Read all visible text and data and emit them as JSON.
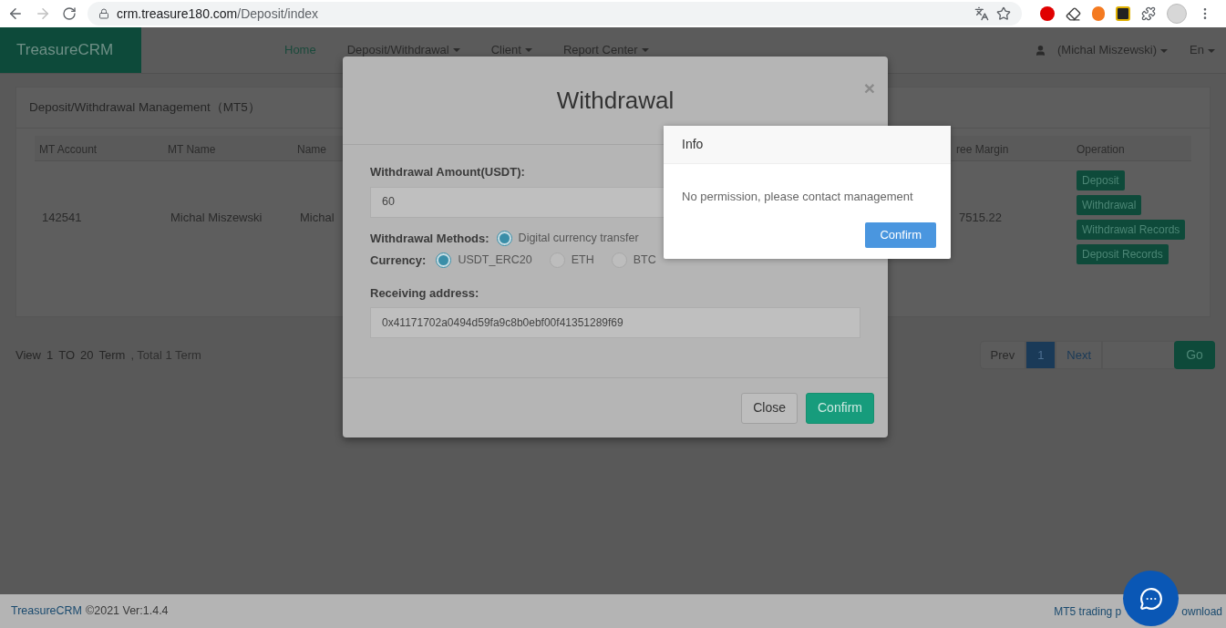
{
  "browser": {
    "url_host": "crm.treasure180.com",
    "url_path": "/Deposit/index"
  },
  "navbar": {
    "logo": "TreasureCRM",
    "items": [
      {
        "label": "Home",
        "selected": true,
        "dropdown": false
      },
      {
        "label": "Deposit/Withdrawal",
        "selected": false,
        "dropdown": true
      },
      {
        "label": "Client",
        "selected": false,
        "dropdown": true
      },
      {
        "label": "Report Center",
        "selected": false,
        "dropdown": true
      }
    ],
    "user": "(Michal Miszewski)",
    "language": "En"
  },
  "panel": {
    "title": "Deposit/Withdrawal Management（MT5）",
    "table": {
      "columns": [
        "MT Account",
        "MT Name",
        "Name",
        "ree Margin",
        "Operation"
      ],
      "rows": [
        {
          "cells": [
            "142541",
            "Michal Miszewski",
            "Michal",
            "7515.22"
          ],
          "actions": [
            "Deposit",
            "Withdrawal",
            "Withdrawal Records",
            "Deposit Records"
          ]
        }
      ]
    }
  },
  "pagination": {
    "summary_parts": [
      "View",
      "1",
      "TO",
      "20",
      "Term"
    ],
    "total": ", Total 1 Term",
    "prev": "Prev",
    "pages": [
      {
        "label": "1",
        "selected": true
      }
    ],
    "next": "Next",
    "go": "Go"
  },
  "footer": {
    "brand": "TreasureCRM",
    "copyright": "©2021 Ver:1.4.4",
    "link_parts": [
      "MT5 trading p",
      "ownload"
    ]
  },
  "withdrawal_dialog": {
    "title": "Withdrawal",
    "close_icon": "×",
    "amount_label": "Withdrawal Amount(USDT):",
    "amount_value": "60",
    "methods_label": "Withdrawal Methods:",
    "methods": [
      {
        "label": "Digital currency transfer",
        "selected": true
      }
    ],
    "currency_label": "Currency:",
    "currencies": [
      {
        "label": "USDT_ERC20",
        "selected": true
      },
      {
        "label": "ETH",
        "selected": false
      },
      {
        "label": "BTC",
        "selected": false
      }
    ],
    "address_label": "Receiving address:",
    "address_value": "0x41171702a0494d59fa9c8b0ebf00f41351289f69",
    "buttons": [
      {
        "label": "Close",
        "kind": "secondary"
      },
      {
        "label": "Confirm",
        "kind": "primary"
      }
    ]
  },
  "info_dialog": {
    "title": "Info",
    "message": "No permission, please contact management",
    "button": "Confirm"
  }
}
